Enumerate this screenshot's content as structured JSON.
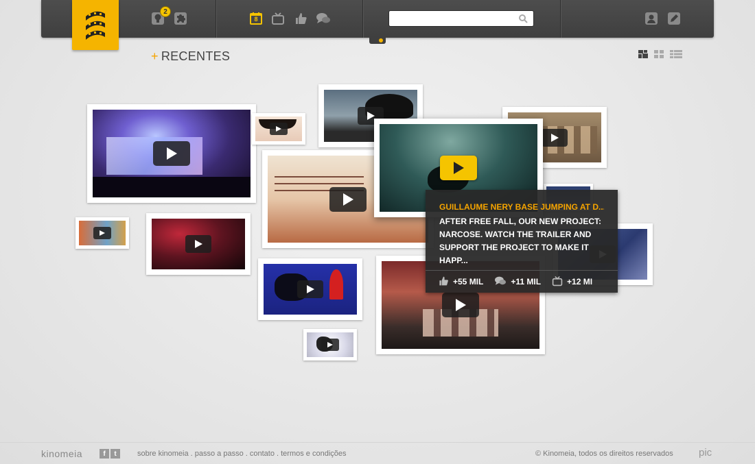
{
  "header": {
    "badge_count": "2",
    "calendar_day": "8",
    "search": {
      "placeholder": "",
      "value": ""
    }
  },
  "section": {
    "plus": "+",
    "title": "RECENTES"
  },
  "tooltip": {
    "title": "GUILLAUME NERY BASE JUMPING AT D...",
    "description": "AFTER FREE FALL, OUR NEW PROJECT: NARCOSE. WATCH THE TRAILER AND SUPPORT THE PROJECT TO MAKE IT HAPP...",
    "likes": "+55 MIL",
    "comments": "+11 MIL",
    "views": "+12 MI"
  },
  "footer": {
    "brand": "kinomeia",
    "facebook": "f",
    "twitter": "t",
    "links": "sobre kinomeia . passo a passo . contato . termos e condições",
    "copyright": "© Kinomeia, todos os direitos reservados",
    "pic": "pic"
  },
  "colors": {
    "accent": "#f5b400",
    "topbar": "#454545",
    "tooltip_bg": "#2a2a2a"
  }
}
